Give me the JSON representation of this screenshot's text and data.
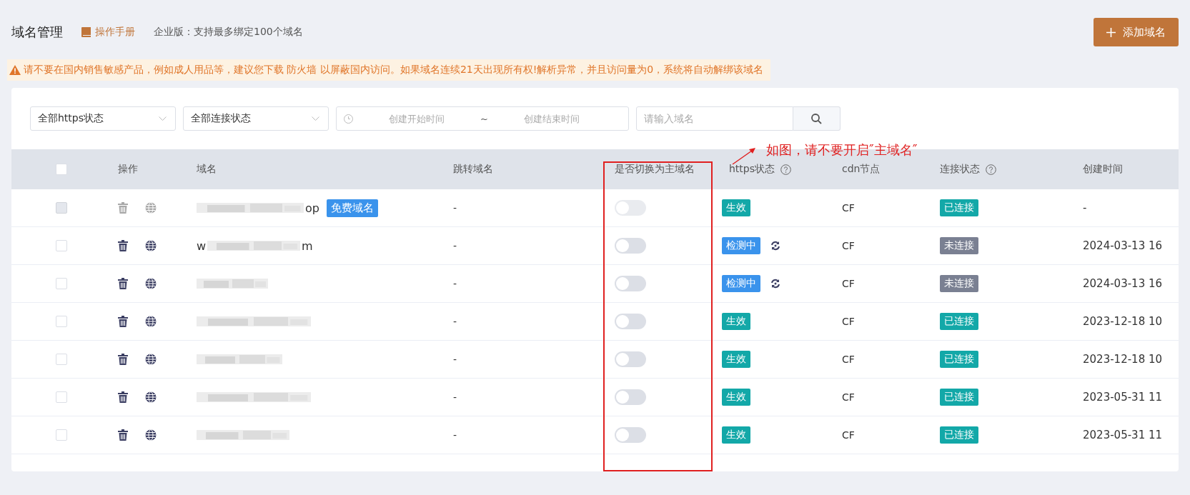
{
  "header": {
    "title": "域名管理",
    "manual_link": "操作手册",
    "plan_note": "企业版：支持最多绑定100个域名",
    "add_button": "添加域名"
  },
  "warning": "请不要在国内销售敏感产品，例如成人用品等，建议您下载 防火墙 以屏蔽国内访问。如果域名连续21天出现所有权!解析异常，并且访问量为0，系统将自动解绑该域名",
  "filters": {
    "https_select": "全部https状态",
    "connection_select": "全部连接状态",
    "start_placeholder": "创建开始时间",
    "range_separator": "~",
    "end_placeholder": "创建结束时间",
    "domain_placeholder": "请输入域名"
  },
  "annotation": {
    "text": "如图，请不要开启″主域名″"
  },
  "table": {
    "select_all": {
      "checked": false
    },
    "columns": [
      {
        "label": "操作"
      },
      {
        "label": "域名"
      },
      {
        "label": "跳转域名"
      },
      {
        "label": "是否切换为主域名"
      },
      {
        "label": "https状态",
        "help": true
      },
      {
        "label": "cdn节点"
      },
      {
        "label": "连接状态",
        "help": true
      },
      {
        "label": "创建时间"
      }
    ],
    "rows": [
      {
        "checked": false,
        "disabled": true,
        "domain_tail": "op",
        "free_tag": "免费域名",
        "redirect": "-",
        "main_domain": false,
        "https": {
          "kind": "active",
          "label": "生效"
        },
        "cdn": "CF",
        "connection": {
          "kind": "connected",
          "label": "已连接"
        },
        "created": "-"
      },
      {
        "checked": false,
        "disabled": false,
        "domain_head": "w",
        "domain_tail": "m",
        "redirect": "-",
        "main_domain": false,
        "https": {
          "kind": "checking",
          "label": "检测中"
        },
        "cdn": "CF",
        "connection": {
          "kind": "disconnected",
          "label": "未连接"
        },
        "created": "2024-03-13 16"
      },
      {
        "checked": false,
        "disabled": false,
        "redirect": "-",
        "main_domain": false,
        "https": {
          "kind": "checking",
          "label": "检测中"
        },
        "cdn": "CF",
        "connection": {
          "kind": "disconnected",
          "label": "未连接"
        },
        "created": "2024-03-13 16"
      },
      {
        "checked": false,
        "disabled": false,
        "redirect": "-",
        "main_domain": false,
        "https": {
          "kind": "active",
          "label": "生效"
        },
        "cdn": "CF",
        "connection": {
          "kind": "connected",
          "label": "已连接"
        },
        "created": "2023-12-18 10"
      },
      {
        "checked": false,
        "disabled": false,
        "redirect": "-",
        "main_domain": false,
        "https": {
          "kind": "active",
          "label": "生效"
        },
        "cdn": "CF",
        "connection": {
          "kind": "connected",
          "label": "已连接"
        },
        "created": "2023-12-18 10"
      },
      {
        "checked": false,
        "disabled": false,
        "redirect": "-",
        "main_domain": false,
        "https": {
          "kind": "active",
          "label": "生效"
        },
        "cdn": "CF",
        "connection": {
          "kind": "connected",
          "label": "已连接"
        },
        "created": "2023-05-31 11"
      },
      {
        "checked": false,
        "disabled": false,
        "redirect": "-",
        "main_domain": false,
        "https": {
          "kind": "active",
          "label": "生效"
        },
        "cdn": "CF",
        "connection": {
          "kind": "connected",
          "label": "已连接"
        },
        "created": "2023-05-31 11"
      }
    ]
  }
}
